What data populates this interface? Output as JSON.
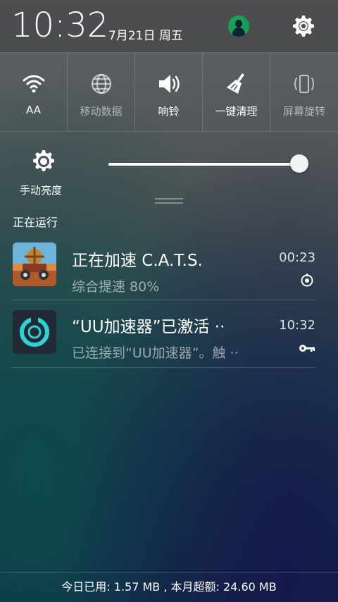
{
  "status": {
    "time": "10:32",
    "date": "7月21日 周五"
  },
  "icons": {
    "avatar": "user-avatar-icon",
    "settings": "gear-icon"
  },
  "quick_settings": [
    {
      "label": "AA",
      "icon": "wifi-icon",
      "enabled": true
    },
    {
      "label": "移动数据",
      "icon": "globe-icon",
      "enabled": false
    },
    {
      "label": "响铃",
      "icon": "speaker-icon",
      "enabled": true
    },
    {
      "label": "一键清理",
      "icon": "broom-icon",
      "enabled": true
    },
    {
      "label": "屏幕旋转",
      "icon": "rotate-phone-icon",
      "enabled": false
    }
  ],
  "brightness": {
    "label": "手动亮度",
    "level": 1.0
  },
  "notifications": {
    "section_title": "正在运行",
    "items": [
      {
        "title": "正在加速 C.A.T.S.",
        "subtitle": "综合提速 80%",
        "time": "00:23",
        "status_icon": "target-icon"
      },
      {
        "title": "“UU加速器”已激活 ··",
        "subtitle": "已连接到“UU加速器”。触 ··",
        "time": "10:32",
        "status_icon": "key-icon"
      }
    ]
  },
  "footer": {
    "usage": "今日已用: 1.57 MB , 本月超额: 24.60 MB"
  },
  "colors": {
    "avatar_bg": "#17a155",
    "uu_ring": "#2ed3d6"
  }
}
